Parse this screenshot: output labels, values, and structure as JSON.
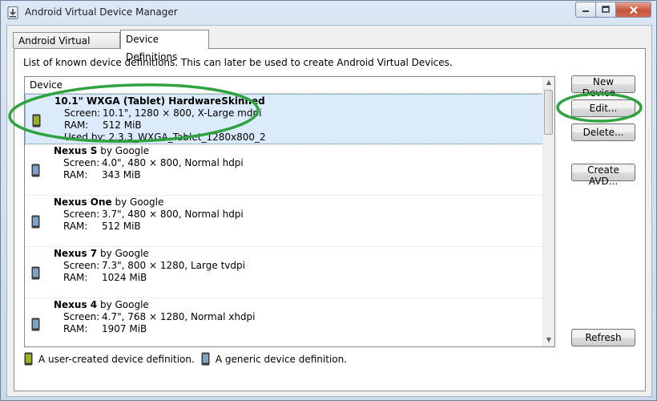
{
  "window": {
    "title": "Android Virtual Device Manager"
  },
  "tabs": [
    {
      "label": "Android Virtual Devices",
      "active": false
    },
    {
      "label": "Device Definitions",
      "active": true
    }
  ],
  "panel": {
    "description": "List of known device definitions. This can later be used to create Android Virtual Devices.",
    "column_header": "Device"
  },
  "labels": {
    "screen": "Screen:",
    "ram": "RAM:",
    "used_by": "Used by:"
  },
  "devices": [
    {
      "name": "10.1\" WXGA (Tablet) HardwareSkinned",
      "by": "",
      "screen": "10.1\", 1280 × 800, X-Large mdpi",
      "ram": "512 MiB",
      "used_by": "2.3.3_WXGA_Tablet_1280x800_2",
      "type": "user",
      "selected": true
    },
    {
      "name": "Nexus S",
      "by": "by Google",
      "screen": "4.0\", 480 × 800, Normal hdpi",
      "ram": "343 MiB",
      "type": "generic"
    },
    {
      "name": "Nexus One",
      "by": "by Google",
      "screen": "3.7\", 480 × 800, Normal hdpi",
      "ram": "512 MiB",
      "type": "generic"
    },
    {
      "name": "Nexus 7",
      "by": "by Google",
      "screen": "7.3\", 800 × 1280, Large tvdpi",
      "ram": "1024 MiB",
      "type": "generic"
    },
    {
      "name": "Nexus 4",
      "by": "by Google",
      "screen": "4.7\", 768 × 1280, Normal xhdpi",
      "ram": "1907 MiB",
      "type": "generic"
    }
  ],
  "buttons": {
    "new_device": "New Device...",
    "edit": "Edit...",
    "delete": "Delete...",
    "create_avd": "Create AVD...",
    "refresh": "Refresh"
  },
  "legend": {
    "user": "A user-created device definition.",
    "generic": "A generic device definition."
  },
  "colors": {
    "user_icon": "#9ab321",
    "generic_icon": "#5a7fa6",
    "selection": "#dbebfb",
    "annotation": "#2fa33f"
  },
  "icons": {
    "app": "android-device-icon",
    "user_device": "user-device-icon",
    "generic_device": "generic-device-icon"
  }
}
